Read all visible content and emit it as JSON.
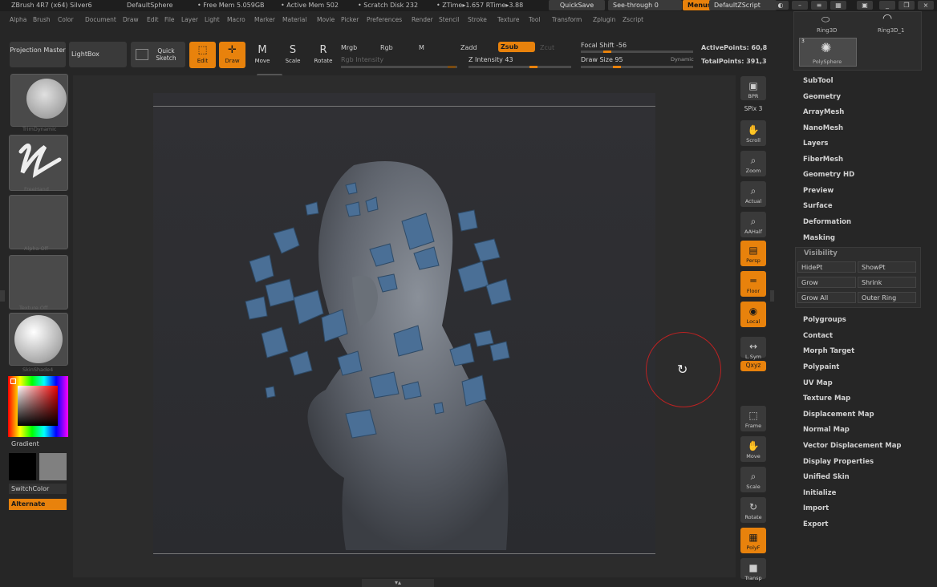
{
  "titlebar": {
    "app": "ZBrush 4R7 (x64) Silver6",
    "document": "DefaultSphere",
    "free_mem": "• Free Mem 5.059GB",
    "active_mem": "• Active Mem 502",
    "scratch_disk": "• Scratch Disk 232",
    "ztime": "• ZTime▸1.657 RTime▸3.88",
    "quicksave": "QuickSave",
    "see_through": "See-through  0",
    "menus": "Menus",
    "default_zscript": "DefaultZScript"
  },
  "menubar": [
    "Alpha",
    "Brush",
    "Color",
    "Document",
    "Draw",
    "Edit",
    "File",
    "Layer",
    "Light",
    "Macro",
    "Marker",
    "Material",
    "Movie",
    "Picker",
    "Preferences",
    "Render",
    "Stencil",
    "Stroke",
    "Texture",
    "Tool",
    "Transform",
    "Zplugin",
    "Zscript"
  ],
  "toolbar": {
    "projection_master": "Projection Master",
    "lightbox": "LightBox",
    "quick_sketch": "Quick Sketch",
    "edit": "Edit",
    "draw": "Draw",
    "move": "Move",
    "scale": "Scale",
    "rotate": "Rotate",
    "mrgb": "Mrgb",
    "rgb": "Rgb",
    "m": "M",
    "rgb_intensity": "Rgb Intensity",
    "zadd": "Zadd",
    "zsub": "Zsub",
    "zcut": "Zcut",
    "z_intensity": "Z Intensity 43",
    "focal_shift": "Focal Shift -56",
    "draw_size": "Draw Size 95",
    "dynamic": "Dynamic",
    "active_points": "ActivePoints: 60,8",
    "total_points": "TotalPoints: 391,3"
  },
  "leftshelf": {
    "brush": "TrimDynamic",
    "stroke": "FreeHand",
    "alpha": "Alpha Off",
    "texture": "Texture Off",
    "material": "SkinShade4",
    "gradient": "Gradient",
    "switchcolor": "SwitchColor",
    "alternate": "Alternate"
  },
  "rightshelf": [
    {
      "label": "BPR",
      "on": false,
      "icon": "▣"
    },
    {
      "label": "SPix 3",
      "on": false,
      "icon": ""
    },
    {
      "label": "Scroll",
      "on": false,
      "icon": "✋"
    },
    {
      "label": "Zoom",
      "on": false,
      "icon": "⌕"
    },
    {
      "label": "Actual",
      "on": false,
      "icon": "⌕"
    },
    {
      "label": "AAHalf",
      "on": false,
      "icon": "⌕"
    },
    {
      "label": "Persp",
      "on": true,
      "icon": "▤"
    },
    {
      "label": "Floor",
      "on": true,
      "icon": "═"
    },
    {
      "label": "Local",
      "on": true,
      "icon": "◉"
    },
    {
      "label": "L.Sym",
      "on": false,
      "icon": "↔"
    },
    {
      "label": "Qxyz",
      "on": true,
      "icon": ""
    },
    {
      "label": "Frame",
      "on": false,
      "icon": "⬚"
    },
    {
      "label": "Move",
      "on": false,
      "icon": "✋"
    },
    {
      "label": "Scale",
      "on": false,
      "icon": "⌕"
    },
    {
      "label": "Rotate",
      "on": false,
      "icon": "↻"
    },
    {
      "label": "PolyF",
      "on": true,
      "icon": "▦"
    },
    {
      "label": "Transp",
      "on": false,
      "icon": "■"
    }
  ],
  "palette": {
    "subtools": [
      {
        "label": "Ring3D"
      },
      {
        "label": "Ring3D_1"
      },
      {
        "label": "PolySphere",
        "count": "3"
      }
    ],
    "items": [
      "SubTool",
      "Geometry",
      "ArrayMesh",
      "NanoMesh",
      "Layers",
      "FiberMesh",
      "Geometry HD",
      "Preview",
      "Surface",
      "Deformation",
      "Masking"
    ],
    "visibility": {
      "title": "Visibility",
      "buttons": [
        "HidePt",
        "ShowPt",
        "Grow",
        "Shrink",
        "Grow All",
        "Outer Ring"
      ]
    },
    "items2": [
      "Polygroups",
      "Contact",
      "Morph Target",
      "Polypaint",
      "UV Map",
      "Texture Map",
      "Displacement Map",
      "Normal Map",
      "Vector Displacement Map",
      "Display Properties",
      "Unified Skin",
      "Initialize",
      "Import",
      "Export"
    ]
  },
  "colors": {
    "accent": "#e8820c",
    "panel": "#3a3a3a",
    "background": "#262626"
  }
}
